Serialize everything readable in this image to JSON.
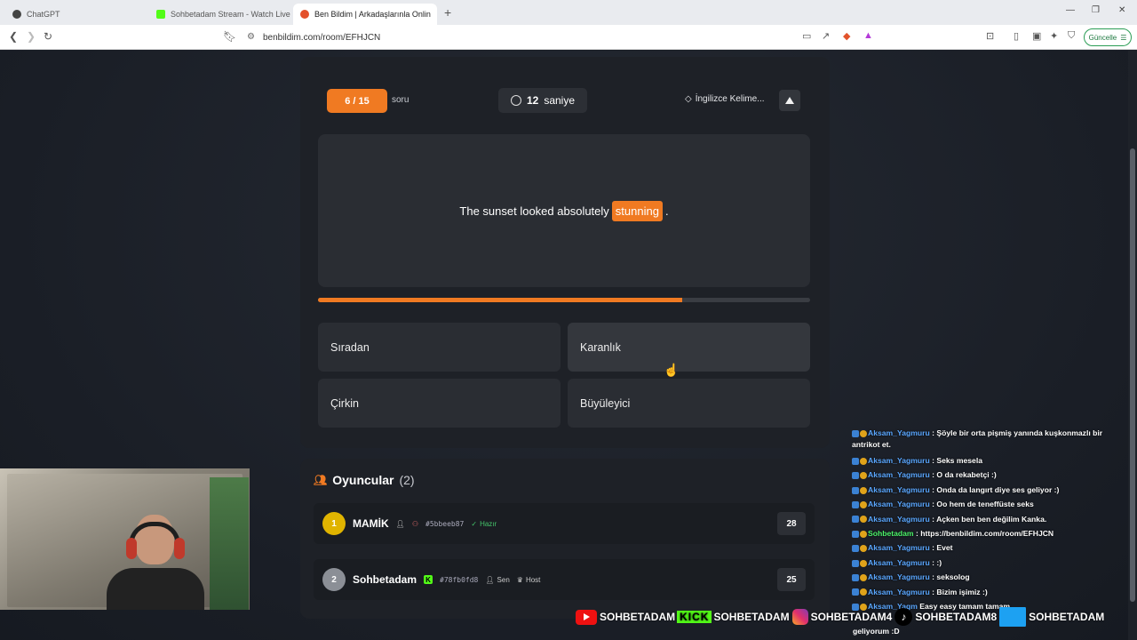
{
  "browser": {
    "tabs": [
      {
        "title": "ChatGPT"
      },
      {
        "title": "Sohbetadam Stream - Watch Live on"
      },
      {
        "title": "Ben Bildim | Arkadaşlarınla Onlin"
      }
    ],
    "url": "benbildim.com/room/EFHJCN",
    "update_label": "Güncelle"
  },
  "quiz": {
    "question_counter": "6 / 15",
    "question_word": "soru",
    "timer_value": "12",
    "timer_unit": "saniye",
    "category": "İngilizce Kelime...",
    "sentence_before": "The sunset looked absolutely",
    "highlight_word": "stunning",
    "sentence_after": ".",
    "progress_percent": 74,
    "answers": [
      "Sıradan",
      "Karanlık",
      "Çirkin",
      "Büyüleyici"
    ]
  },
  "players": {
    "title": "Oyuncular",
    "count": "(2)",
    "list": [
      {
        "rank": "1",
        "name": "MAMİK",
        "id": "#5bbeeb87",
        "status": "Hazır",
        "score": "28",
        "rank_color": "#e0b400"
      },
      {
        "rank": "2",
        "name": "Sohbetadam",
        "id": "#78fb0fd8",
        "you": "Sen",
        "host": "Host",
        "score": "25",
        "rank_color": "#8b8f96"
      }
    ]
  },
  "chat": {
    "messages": [
      {
        "user": "Aksam_Yagmuru",
        "text": ": Şöyle bir orta pişmiş yanında kuşkonmazlı bir antrikot et."
      },
      {
        "user": "Aksam_Yagmuru",
        "text": ": Seks mesela"
      },
      {
        "user": "Aksam_Yagmuru",
        "text": ": O da rekabetçi :)"
      },
      {
        "user": "Aksam_Yagmuru",
        "text": ": Onda da langırt diye ses geliyor :)"
      },
      {
        "user": "Aksam_Yagmuru",
        "text": ": Oo hem de teneffüste seks"
      },
      {
        "user": "Aksam_Yagmuru",
        "text": ": Açken ben ben değilim Kanka."
      },
      {
        "user": "Sohbetadam",
        "text": ": https://benbildim.com/room/EFHJCN"
      },
      {
        "user": "Aksam_Yagmuru",
        "text": ": Evet"
      },
      {
        "user": "Aksam_Yagmuru",
        "text": ": :)"
      },
      {
        "user": "Aksam_Yagmuru",
        "text": ": seksolog"
      },
      {
        "user": "Aksam_Yagmuru",
        "text": ": Bizim işimiz :)"
      },
      {
        "user": "Aksam_Yagm",
        "text": "Easy easy tamam tamam"
      }
    ],
    "last_line": "geliyorum :D"
  },
  "social": {
    "youtube": "SOHBETADAM",
    "kick_logo": "KICK",
    "kick": "SOHBETADAM",
    "instagram": "SOHBETADAM4",
    "tiktok": "SOHBETADAM8",
    "twitter": "SOHBETADAM"
  }
}
